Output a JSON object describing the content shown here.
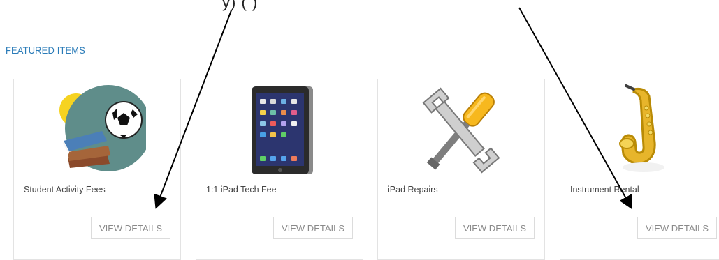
{
  "header_fragment": "y) (                                  )",
  "section_title": "FEATURED ITEMS",
  "items": [
    {
      "name": "Student Activity Fees",
      "button": "VIEW DETAILS",
      "icon": "books-ball-icon"
    },
    {
      "name": "1:1 iPad Tech Fee",
      "button": "VIEW DETAILS",
      "icon": "ipad-icon"
    },
    {
      "name": "iPad Repairs",
      "button": "VIEW DETAILS",
      "icon": "screwdriver-wrench-icon"
    },
    {
      "name": "Instrument Rental",
      "button": "VIEW DETAILS",
      "icon": "saxophone-icon"
    }
  ],
  "colors": {
    "section_title": "#2a7bb8",
    "button_text": "#8a8a8a",
    "card_border": "#e3e3e3"
  }
}
